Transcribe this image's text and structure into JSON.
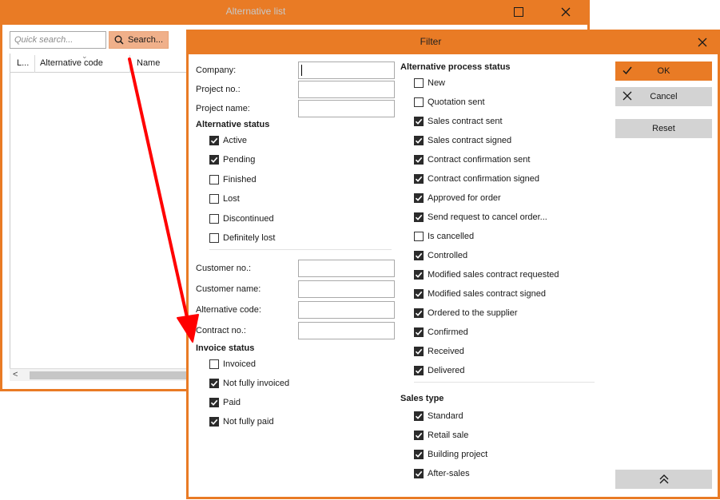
{
  "back_window": {
    "title": "Alternative list",
    "quick_search_placeholder": "Quick search...",
    "search_button_label": "Search...",
    "columns": [
      "L...",
      "Alternative code",
      "Name"
    ],
    "scroll_left_glyph": "<"
  },
  "filter": {
    "title": "Filter",
    "fields_top": [
      {
        "label": "Company:",
        "value": ""
      },
      {
        "label": "Project no.:",
        "value": ""
      },
      {
        "label": "Project name:",
        "value": ""
      }
    ],
    "alternative_status": {
      "header": "Alternative status",
      "items": [
        {
          "label": "Active",
          "checked": true
        },
        {
          "label": "Pending",
          "checked": true
        },
        {
          "label": "Finished",
          "checked": false
        },
        {
          "label": "Lost",
          "checked": false
        },
        {
          "label": "Discontinued",
          "checked": false
        },
        {
          "label": "Definitely lost",
          "checked": false
        }
      ]
    },
    "fields_middle": [
      {
        "label": "Customer no.:",
        "value": ""
      },
      {
        "label": "Customer name:",
        "value": ""
      },
      {
        "label": "Alternative code:",
        "value": ""
      },
      {
        "label": "Contract no.:",
        "value": ""
      }
    ],
    "invoice_status": {
      "header": "Invoice status",
      "items": [
        {
          "label": "Invoiced",
          "checked": false
        },
        {
          "label": "Not fully invoiced",
          "checked": true
        },
        {
          "label": "Paid",
          "checked": true
        },
        {
          "label": "Not fully paid",
          "checked": true
        }
      ]
    },
    "process_status": {
      "header": "Alternative process status",
      "items": [
        {
          "label": "New",
          "checked": false
        },
        {
          "label": "Quotation sent",
          "checked": false
        },
        {
          "label": "Sales contract sent",
          "checked": true
        },
        {
          "label": "Sales contract signed",
          "checked": true
        },
        {
          "label": "Contract confirmation sent",
          "checked": true
        },
        {
          "label": "Contract confirmation signed",
          "checked": true
        },
        {
          "label": "Approved for order",
          "checked": true
        },
        {
          "label": "Send request to cancel order...",
          "checked": true
        },
        {
          "label": "Is cancelled",
          "checked": false
        },
        {
          "label": "Controlled",
          "checked": true
        },
        {
          "label": "Modified sales contract requested",
          "checked": true
        },
        {
          "label": "Modified sales contract signed",
          "checked": true
        },
        {
          "label": "Ordered to the supplier",
          "checked": true
        },
        {
          "label": "Confirmed",
          "checked": true
        },
        {
          "label": "Received",
          "checked": true
        },
        {
          "label": "Delivered",
          "checked": true
        }
      ]
    },
    "sales_type": {
      "header": "Sales type",
      "items": [
        {
          "label": "Standard",
          "checked": true
        },
        {
          "label": "Retail sale",
          "checked": true
        },
        {
          "label": "Building project",
          "checked": true
        },
        {
          "label": "After-sales",
          "checked": true
        }
      ]
    },
    "buttons": {
      "ok": "OK",
      "cancel": "Cancel",
      "reset": "Reset"
    }
  },
  "colors": {
    "accent": "#e97b25",
    "search_button": "#f0b08a",
    "button_gray": "#d3d3d3",
    "annotation_arrow": "#ff0000"
  }
}
